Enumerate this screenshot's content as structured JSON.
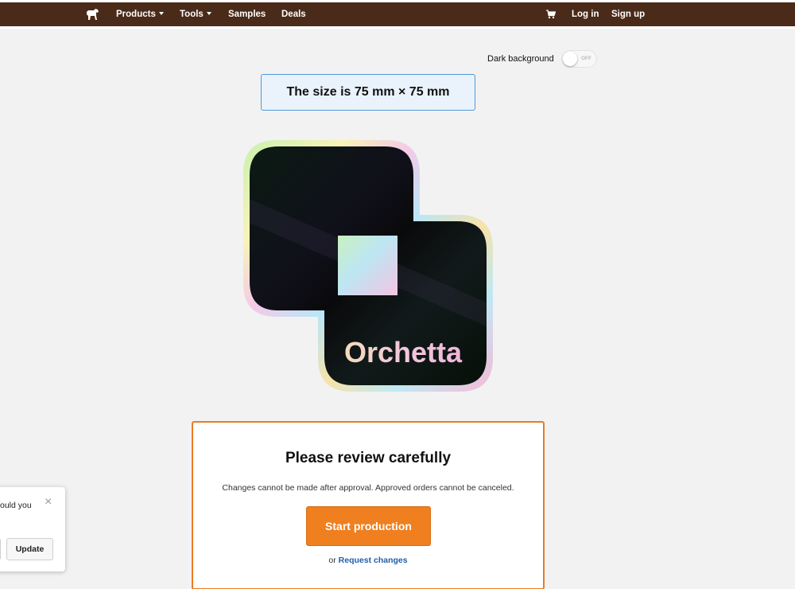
{
  "nav": {
    "logo_icon": "horse-icon",
    "items": [
      {
        "label": "Products",
        "has_dropdown": true
      },
      {
        "label": "Tools",
        "has_dropdown": true
      },
      {
        "label": "Samples",
        "has_dropdown": false
      },
      {
        "label": "Deals",
        "has_dropdown": false
      }
    ],
    "cart_icon": "cart-icon",
    "login_label": "Log in",
    "signup_label": "Sign up"
  },
  "background_toggle": {
    "label": "Dark background",
    "state": "OFF"
  },
  "size_banner": "The size is 75 mm × 75 mm",
  "sticker": {
    "text": "Orchetta",
    "finish": "holographic"
  },
  "review": {
    "title": "Please review carefully",
    "text": "Changes cannot be made after approval. Approved orders cannot be canceled.",
    "start_button_label": "Start production",
    "alt_prefix": "or",
    "request_changes_label": "Request changes"
  },
  "popup": {
    "partial_text": "ould you",
    "close_icon": "close-icon",
    "update_label": "Update"
  },
  "colors": {
    "navbar": "#4a2a19",
    "accent": "#ef7f1f",
    "banner_border": "#4f9ad9",
    "link": "#1f5fa8"
  }
}
